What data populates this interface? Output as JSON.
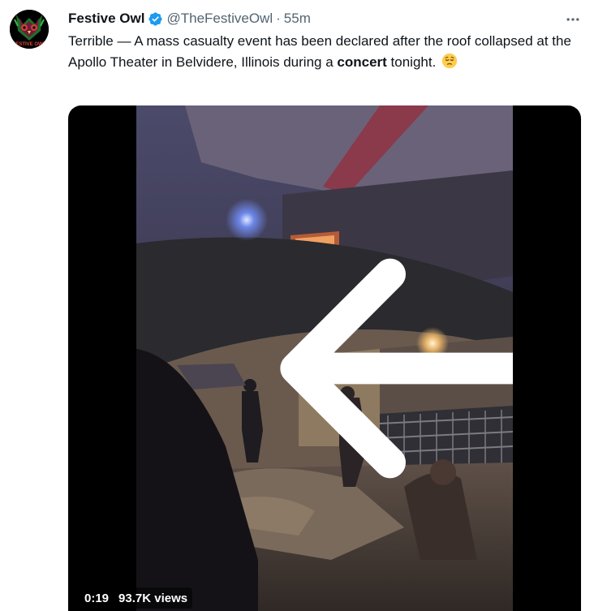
{
  "tweet": {
    "display_name": "Festive Owl",
    "handle": "@TheFestiveOwl",
    "separator": "·",
    "time": "55m",
    "text_before": "Terrible — A mass casualty event has been declared after the roof collapsed at the Apollo Theater in Belvidere, Illinois during a ",
    "text_bold": "concert",
    "text_after": " tonight.",
    "emoji_name": "pensive-face-emoji",
    "avatar_icon": "festive-owl-avatar",
    "avatar_logo_text": "FESTIVE OWL"
  },
  "video": {
    "elapsed": "0:19",
    "views": "93.7K views"
  },
  "colors": {
    "text_primary": "#0f1419",
    "text_secondary": "#536471",
    "verified_blue": "#1d9bf0",
    "media_bg": "#000000"
  }
}
